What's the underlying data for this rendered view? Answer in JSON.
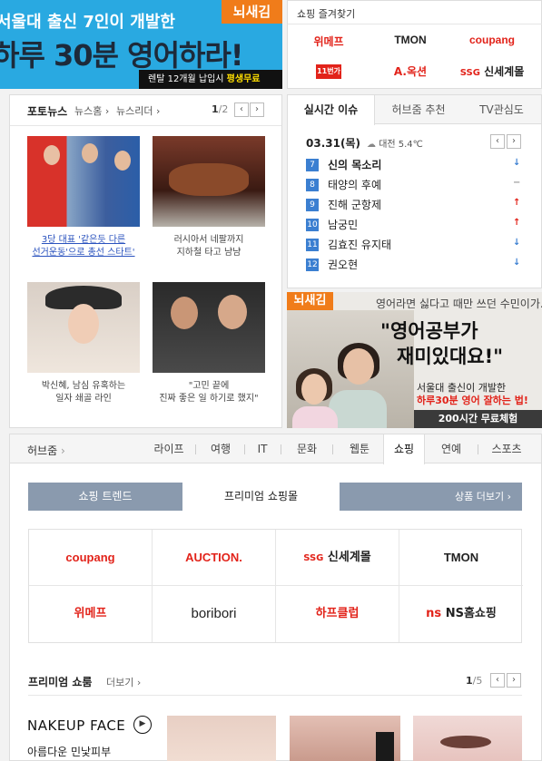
{
  "top_banner": {
    "line1": "서울대 출신 7인이 개발한",
    "line2": "하루 30분 영어하라!",
    "logo": "뇌새김",
    "strip_prefix": "렌탈 12개월 납입시",
    "strip_highlight": "평생무료"
  },
  "shopping_favorites": {
    "title": "쇼핑 즐겨찾기",
    "items": [
      "위메프",
      "TMON",
      "coupang",
      "11번가",
      "A.옥션",
      "신세계몰"
    ],
    "colors": [
      "#e2231a",
      "#222222",
      "#e2231a",
      "#e2231a",
      "#e2231a",
      "#222222"
    ]
  },
  "photo_news": {
    "tabs": [
      "포토뉴스",
      "뉴스홈",
      "뉴스리더"
    ],
    "page_current": "1",
    "page_total": "/2",
    "prev": "‹",
    "next": "›",
    "items": [
      {
        "caption_l1": "3당 대표 '같은듯 다른",
        "caption_l2": "선거운동'으로 총선 스타트'"
      },
      {
        "caption_l1": "러시아서 네팔까지",
        "caption_l2": "지하철 타고 냠냠"
      },
      {
        "caption_l1": "박신혜, 남심 유혹하는",
        "caption_l2": "일자 쇄골 라인"
      },
      {
        "caption_l1": "\"고민 끝에",
        "caption_l2": "진짜 좋은 일 하기로 했지\""
      }
    ]
  },
  "realtime": {
    "tabs": [
      "실시간 이슈",
      "허브줌 추천",
      "TV관심도"
    ],
    "date": "03.31(목)",
    "weather": "대전 5.4℃",
    "prev": "‹",
    "next": "›",
    "items": [
      {
        "rank": "7",
        "text": "신의 목소리",
        "change": "↓",
        "color": "#3b7fd1"
      },
      {
        "rank": "8",
        "text": "태양의 후예",
        "change": "−",
        "color": "#999999"
      },
      {
        "rank": "9",
        "text": "진해 군항제",
        "change": "↑",
        "color": "#e2231a"
      },
      {
        "rank": "10",
        "text": "남궁민",
        "change": "↑",
        "color": "#e2231a"
      },
      {
        "rank": "11",
        "text": "김효진 유지태",
        "change": "↓",
        "color": "#3b7fd1"
      },
      {
        "rank": "12",
        "text": "권오현",
        "change": "↓",
        "color": "#3b7fd1"
      }
    ]
  },
  "ad_banner": {
    "logo": "뇌새김",
    "top_text": "영어라면 싫다고 때만 쓰던 수민이가..",
    "quote_l1": "\"영어공부가",
    "quote_l2": "재미있대요!\"",
    "sub_l1": "서울대 출신이 개발한",
    "sub_l2": "하루30분 영어 잘하는 법!",
    "cta": "200시간 무료체험"
  },
  "hub": {
    "title": "허브줌",
    "nav": [
      "라이프",
      "여행",
      "IT",
      "문화",
      "웹툰",
      "쇼핑",
      "연예",
      "스포츠"
    ],
    "active": "쇼핑",
    "shop_tabs": [
      "쇼핑 트렌드",
      "프리미엄 쇼핑몰"
    ],
    "shop_more": "상품 더보기 ›",
    "shops": [
      {
        "name": "coupang",
        "color": "#e2231a"
      },
      {
        "name": "AUCTION.",
        "color": "#e2231a"
      },
      {
        "name": "신세계몰",
        "color": "#222222"
      },
      {
        "name": "TMON",
        "color": "#222222"
      },
      {
        "name": "위메프",
        "color": "#e2231a"
      },
      {
        "name": "boribori",
        "color": "#222222"
      },
      {
        "name": "하프클럽",
        "color": "#e2231a"
      },
      {
        "name": "NS홈쇼핑",
        "color": "#222222"
      }
    ],
    "premium_title": "프리미엄 쇼룸",
    "premium_more": "더보기 ›",
    "premium_page_current": "1",
    "premium_page_total": "/5",
    "prev": "‹",
    "next": "›",
    "nakeup_logo": "NAKEUP FACE",
    "nakeup_play": "▶",
    "nakeup_text": "아름다운 민낯피부"
  }
}
